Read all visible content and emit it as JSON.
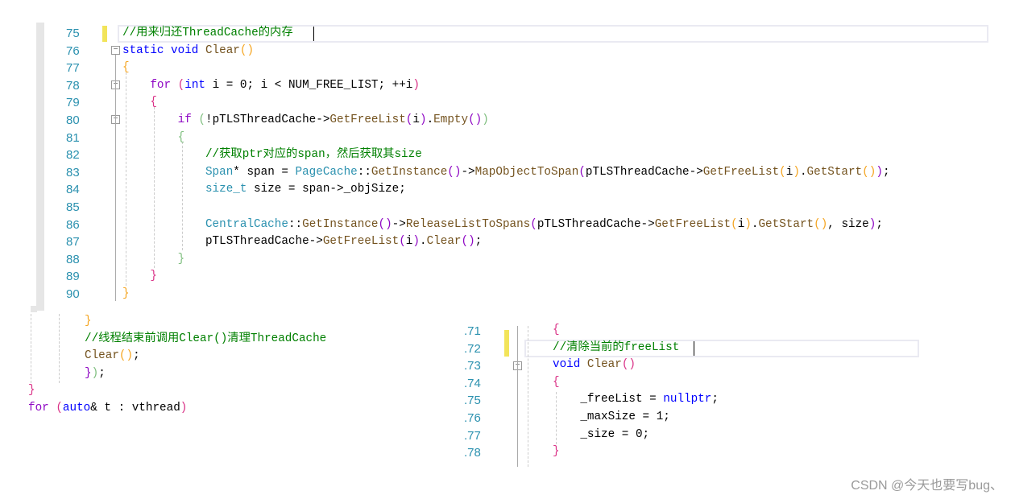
{
  "top_panel": {
    "line_numbers": [
      "75",
      "76",
      "77",
      "78",
      "79",
      "80",
      "81",
      "82",
      "83",
      "84",
      "85",
      "86",
      "87",
      "88",
      "89",
      "90"
    ],
    "lines": [
      [
        [
          "//用来归还ThreadCache的内存",
          "cm"
        ]
      ],
      [
        [
          "static void ",
          "kw"
        ],
        [
          "Clear",
          "fn"
        ],
        [
          "()",
          "b1"
        ]
      ],
      [
        [
          "{",
          "b1"
        ]
      ],
      [
        [
          "    "
        ],
        [
          "for",
          "ctl"
        ],
        [
          " (",
          "b2"
        ],
        [
          "int",
          "kw"
        ],
        [
          " i = 0; i < NUM_FREE_LIST; ++i"
        ],
        [
          ")",
          "b2"
        ]
      ],
      [
        [
          "    "
        ],
        [
          "{",
          "b2"
        ]
      ],
      [
        [
          "        "
        ],
        [
          "if",
          "ctl"
        ],
        [
          " (",
          "b3"
        ],
        [
          "!pTLSThreadCache->"
        ],
        [
          "GetFreeList",
          "fn"
        ],
        [
          "(",
          "b4"
        ],
        [
          "i"
        ],
        [
          ")",
          "b4"
        ],
        [
          "."
        ],
        [
          "Empty",
          "fn"
        ],
        [
          "()",
          "b4"
        ],
        [
          ")",
          "b3"
        ]
      ],
      [
        [
          "        "
        ],
        [
          "{",
          "b3"
        ]
      ],
      [
        [
          "            "
        ],
        [
          "//获取ptr对应的span，然后获取其size",
          "cm"
        ]
      ],
      [
        [
          "            "
        ],
        [
          "Span",
          "cls"
        ],
        [
          "* span = "
        ],
        [
          "PageCache",
          "cls"
        ],
        [
          "::"
        ],
        [
          "GetInstance",
          "fn"
        ],
        [
          "()",
          "b4"
        ],
        [
          "->"
        ],
        [
          "MapObjectToSpan",
          "fn"
        ],
        [
          "(",
          "b4"
        ],
        [
          "pTLSThreadCache->"
        ],
        [
          "GetFreeList",
          "fn"
        ],
        [
          "(",
          "b1"
        ],
        [
          "i"
        ],
        [
          ")",
          "b1"
        ],
        [
          "."
        ],
        [
          "GetStart",
          "fn"
        ],
        [
          "()",
          "b1"
        ],
        [
          ")",
          "b4"
        ],
        [
          ";"
        ]
      ],
      [
        [
          "            "
        ],
        [
          "size_t",
          "cls"
        ],
        [
          " size = span->_objSize;"
        ]
      ],
      [
        [
          ""
        ]
      ],
      [
        [
          "            "
        ],
        [
          "CentralCache",
          "cls"
        ],
        [
          "::"
        ],
        [
          "GetInstance",
          "fn"
        ],
        [
          "()",
          "b4"
        ],
        [
          "->"
        ],
        [
          "ReleaseListToSpans",
          "fn"
        ],
        [
          "(",
          "b4"
        ],
        [
          "pTLSThreadCache->"
        ],
        [
          "GetFreeList",
          "fn"
        ],
        [
          "(",
          "b1"
        ],
        [
          "i"
        ],
        [
          ")",
          "b1"
        ],
        [
          "."
        ],
        [
          "GetStart",
          "fn"
        ],
        [
          "()",
          "b1"
        ],
        [
          ", size"
        ],
        [
          ")",
          "b4"
        ],
        [
          ";"
        ]
      ],
      [
        [
          "            "
        ],
        [
          "pTLSThreadCache->"
        ],
        [
          "GetFreeList",
          "fn"
        ],
        [
          "(",
          "b4"
        ],
        [
          "i"
        ],
        [
          ")",
          "b4"
        ],
        [
          "."
        ],
        [
          "Clear",
          "fn"
        ],
        [
          "()",
          "b4"
        ],
        [
          ";"
        ]
      ],
      [
        [
          "        "
        ],
        [
          "}",
          "b3"
        ]
      ],
      [
        [
          "    "
        ],
        [
          "}",
          "b2"
        ]
      ],
      [
        [
          "}",
          "b1"
        ]
      ]
    ]
  },
  "bottom_left": {
    "lines": [
      [
        [
          "}",
          "b1"
        ]
      ],
      [
        [
          "//线程结束前调用Clear()清理ThreadCache",
          "cm"
        ]
      ],
      [
        [
          "Clear",
          "fn"
        ],
        [
          "()",
          "b1"
        ],
        [
          ";"
        ]
      ],
      [
        [
          "}",
          "b4"
        ],
        [
          ")",
          "b3"
        ],
        [
          ";"
        ]
      ]
    ],
    "outer_lines": [
      [
        [
          "}",
          "b2"
        ]
      ],
      [
        [
          "for",
          "ctl"
        ],
        [
          " (",
          "b2"
        ],
        [
          "auto",
          "kw"
        ],
        [
          "& t : vthread"
        ],
        [
          ")",
          "b2"
        ]
      ]
    ]
  },
  "bottom_right": {
    "line_numbers": [
      ".71",
      ".72",
      ".73",
      ".74",
      ".75",
      ".76",
      ".77",
      ".78"
    ],
    "lines": [
      [
        [
          "{",
          "b2"
        ]
      ],
      [
        [
          "//清除当前的freeList",
          "cm"
        ]
      ],
      [
        [
          "void ",
          "kw"
        ],
        [
          "Clear",
          "fn"
        ],
        [
          "()",
          "b2"
        ]
      ],
      [
        [
          "{",
          "b2"
        ]
      ],
      [
        [
          "    _freeList = "
        ],
        [
          "nullptr",
          "kw"
        ],
        [
          ";"
        ]
      ],
      [
        [
          "    _maxSize = 1;"
        ]
      ],
      [
        [
          "    _size = 0;"
        ]
      ],
      [
        [
          "}",
          "b2"
        ]
      ]
    ]
  },
  "watermark": "CSDN @今天也要写bug、"
}
